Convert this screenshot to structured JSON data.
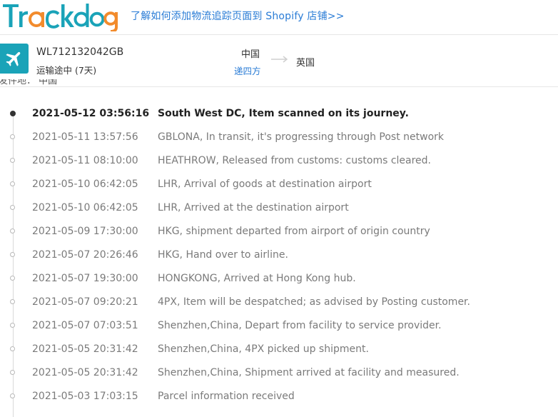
{
  "header": {
    "logo_text": "Trackdog",
    "promo_link": "了解如何添加物流追踪页面到 Shopify 店铺>>"
  },
  "shipment": {
    "tracking_number": "WL712132042GB",
    "status": "运输途中 (7天)",
    "origin_country": "中国",
    "origin_carrier": "递四方",
    "destination_country": "英国",
    "partial_line": "发件地： 中国"
  },
  "colors": {
    "brand_teal": "#1aa3b8",
    "brand_orange": "#f28b2c",
    "link_blue": "#2a7cd6"
  },
  "events": [
    {
      "time": "2021-05-12 03:56:16",
      "desc": "South West DC, Item scanned on its journey.",
      "latest": true
    },
    {
      "time": "2021-05-11 13:57:56",
      "desc": "GBLONA, In transit, it's progressing through Post network"
    },
    {
      "time": "2021-05-11 08:10:00",
      "desc": "HEATHROW, Released from customs: customs cleared."
    },
    {
      "time": "2021-05-10 06:42:05",
      "desc": "LHR, Arrival of goods at destination airport"
    },
    {
      "time": "2021-05-10 06:42:05",
      "desc": "LHR, Arrived at the destination airport"
    },
    {
      "time": "2021-05-09 17:30:00",
      "desc": "HKG, shipment departed from airport of origin country"
    },
    {
      "time": "2021-05-07 20:26:46",
      "desc": "HKG, Hand over to airline."
    },
    {
      "time": "2021-05-07 19:30:00",
      "desc": "HONGKONG, Arrived at Hong Kong hub."
    },
    {
      "time": "2021-05-07 09:20:21",
      "desc": "4PX, Item will be despatched; as advised by Posting customer."
    },
    {
      "time": "2021-05-07 07:03:51",
      "desc": "Shenzhen,China, Depart from facility to service provider."
    },
    {
      "time": "2021-05-05 20:31:42",
      "desc": "Shenzhen,China, 4PX picked up shipment."
    },
    {
      "time": "2021-05-05 20:31:42",
      "desc": "Shenzhen,China, Shipment arrived at facility and measured."
    },
    {
      "time": "2021-05-03 17:03:15",
      "desc": "Parcel information received"
    }
  ]
}
